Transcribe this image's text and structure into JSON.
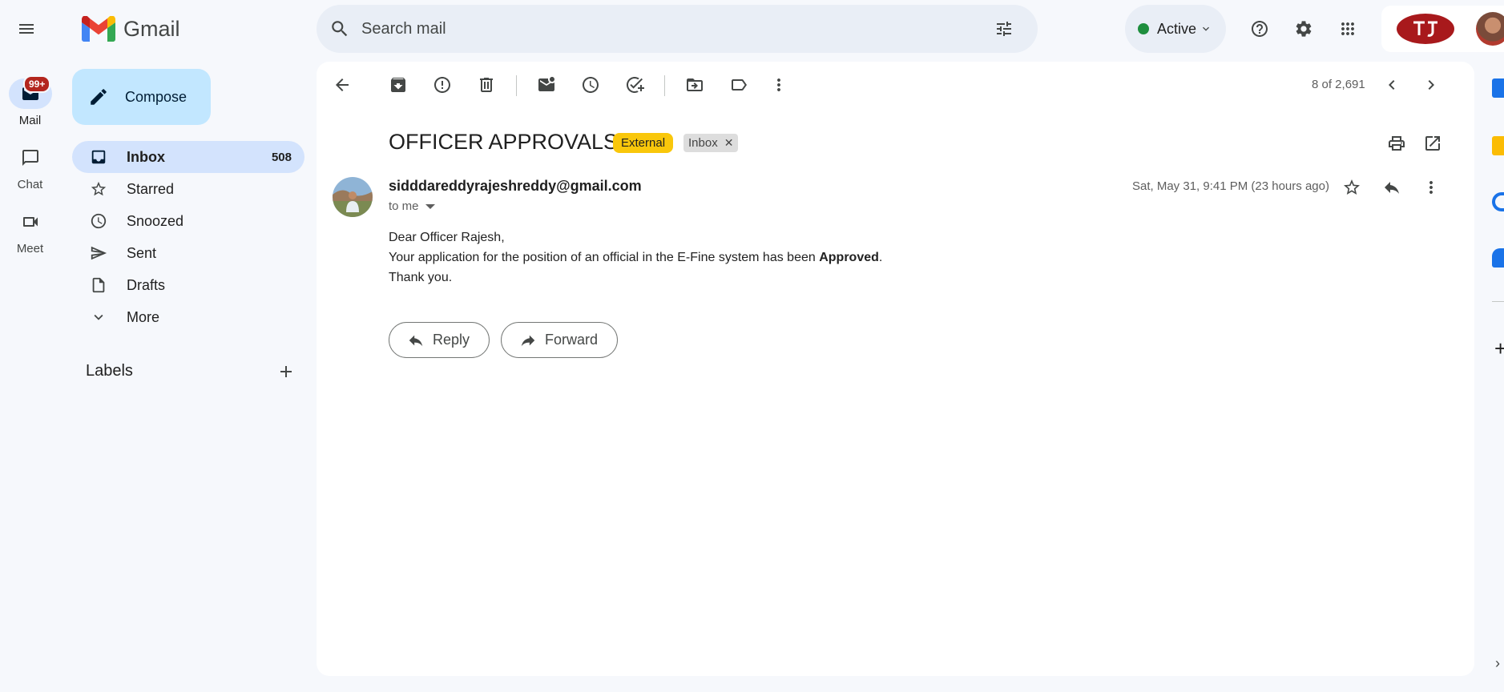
{
  "app": {
    "brand_name": "Gmail",
    "accent_color": "#c2e7ff",
    "active_nav_color": "#d3e3fd"
  },
  "rail": {
    "items": [
      {
        "label": "Mail",
        "icon": "mail-icon"
      },
      {
        "label": "Chat",
        "icon": "chat-icon"
      },
      {
        "label": "Meet",
        "icon": "meet-icon"
      }
    ],
    "badge": "99+"
  },
  "sidebar": {
    "compose_label": "Compose",
    "items": [
      {
        "label": "Inbox",
        "icon": "inbox-icon",
        "count": "508"
      },
      {
        "label": "Starred",
        "icon": "star-icon"
      },
      {
        "label": "Snoozed",
        "icon": "clock-icon"
      },
      {
        "label": "Sent",
        "icon": "send-icon"
      },
      {
        "label": "Drafts",
        "icon": "draft-icon"
      },
      {
        "label": "More",
        "icon": "chevron-down-icon"
      }
    ],
    "labels_heading": "Labels"
  },
  "header": {
    "search_placeholder": "Search mail",
    "status_label": "Active",
    "status_color": "#1e8e3e"
  },
  "toolbar": {
    "pager_text": "8 of 2,691"
  },
  "email": {
    "subject": "OFFICER APPROVALS",
    "external_chip": "External",
    "inbox_chip": "Inbox",
    "sender": "sidddareddyrajeshreddy@gmail.com",
    "recipient": "to me",
    "date": "Sat, May 31, 9:41 PM (23 hours ago)",
    "greeting": "Dear Officer Rajesh,",
    "body_prefix": "Your application for the position of an official in the E-Fine system has been ",
    "body_bold": "Approved",
    "body_suffix": ".",
    "closing": "Thank you."
  },
  "actions": {
    "reply_label": "Reply",
    "forward_label": "Forward"
  }
}
